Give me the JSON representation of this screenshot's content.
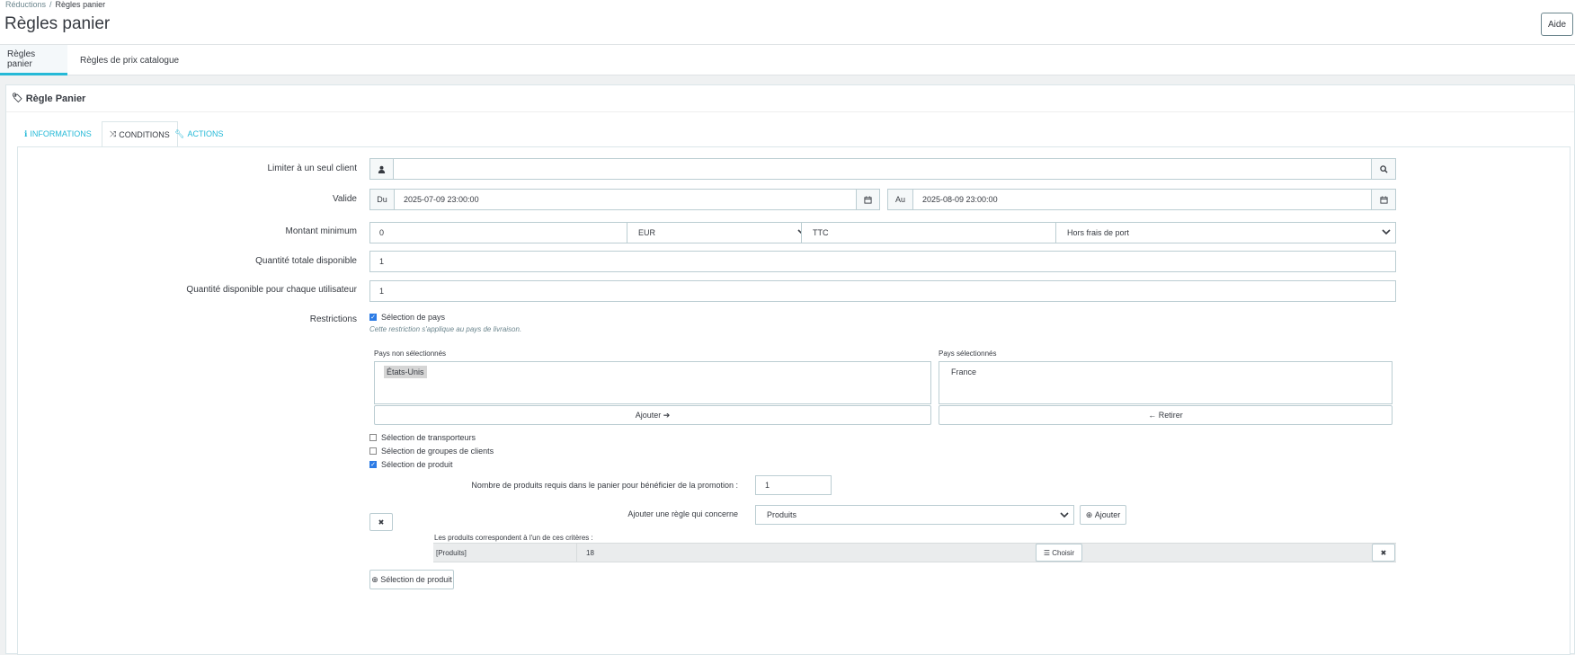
{
  "breadcrumb": {
    "parent": "Réductions",
    "separator": "/",
    "current": "Règles panier"
  },
  "page_title": "Règles panier",
  "help_label": "Aide",
  "subtabs": [
    {
      "label": "Règles panier",
      "active": true
    },
    {
      "label": "Règles de prix catalogue",
      "active": false
    }
  ],
  "panel_title": "Règle Panier",
  "content_tabs": [
    {
      "label": "INFORMATIONS",
      "icon": "info-icon",
      "active": false
    },
    {
      "label": "CONDITIONS",
      "icon": "shuffle-icon",
      "active": true
    },
    {
      "label": "ACTIONS",
      "icon": "wrench-icon",
      "active": false
    }
  ],
  "form": {
    "customer": {
      "label": "Limiter à un seul client",
      "value": ""
    },
    "valid": {
      "label": "Valide",
      "from_prefix": "Du",
      "from_value": "2025-07-09 23:00:00",
      "to_prefix": "Au",
      "to_value": "2025-08-09 23:00:00"
    },
    "minimum": {
      "label": "Montant minimum",
      "amount": "0",
      "currency": "EUR",
      "tax": "TTC",
      "shipping": "Hors frais de port"
    },
    "total_quantity": {
      "label": "Quantité totale disponible",
      "value": "1"
    },
    "user_quantity": {
      "label": "Quantité disponible pour chaque utilisateur",
      "value": "1"
    },
    "restrictions": {
      "label": "Restrictions",
      "country_selection": {
        "label": "Sélection de pays",
        "checked": true,
        "hint": "Cette restriction s'applique au pays de livraison."
      },
      "unselected_label": "Pays non sélectionnés",
      "unselected": [
        "États-Unis"
      ],
      "selected_label": "Pays sélectionnés",
      "selected": [
        "France"
      ],
      "add_label": "Ajouter",
      "remove_label": "Retirer",
      "carrier_selection": {
        "label": "Sélection de transporteurs",
        "checked": false
      },
      "group_selection": {
        "label": "Sélection de groupes de clients",
        "checked": false
      },
      "product_selection": {
        "label": "Sélection de produit",
        "checked": true
      }
    },
    "product_rule": {
      "required_label": "Nombre de produits requis dans le panier pour bénéficier de la promotion :",
      "required_value": "1",
      "add_rule_label": "Ajouter une règle qui concerne",
      "rule_type": "Produits",
      "add_button": "Ajouter",
      "criteria_label": "Les produits correspondent à l'un de ces critères :",
      "criteria": [
        {
          "type": "[Produits]",
          "value": "18",
          "choose_label": "Choisir"
        }
      ],
      "new_selection_label": "Sélection de produit"
    }
  },
  "colors": {
    "accent": "#25b9d7",
    "checkbox": "#2c7be5"
  }
}
